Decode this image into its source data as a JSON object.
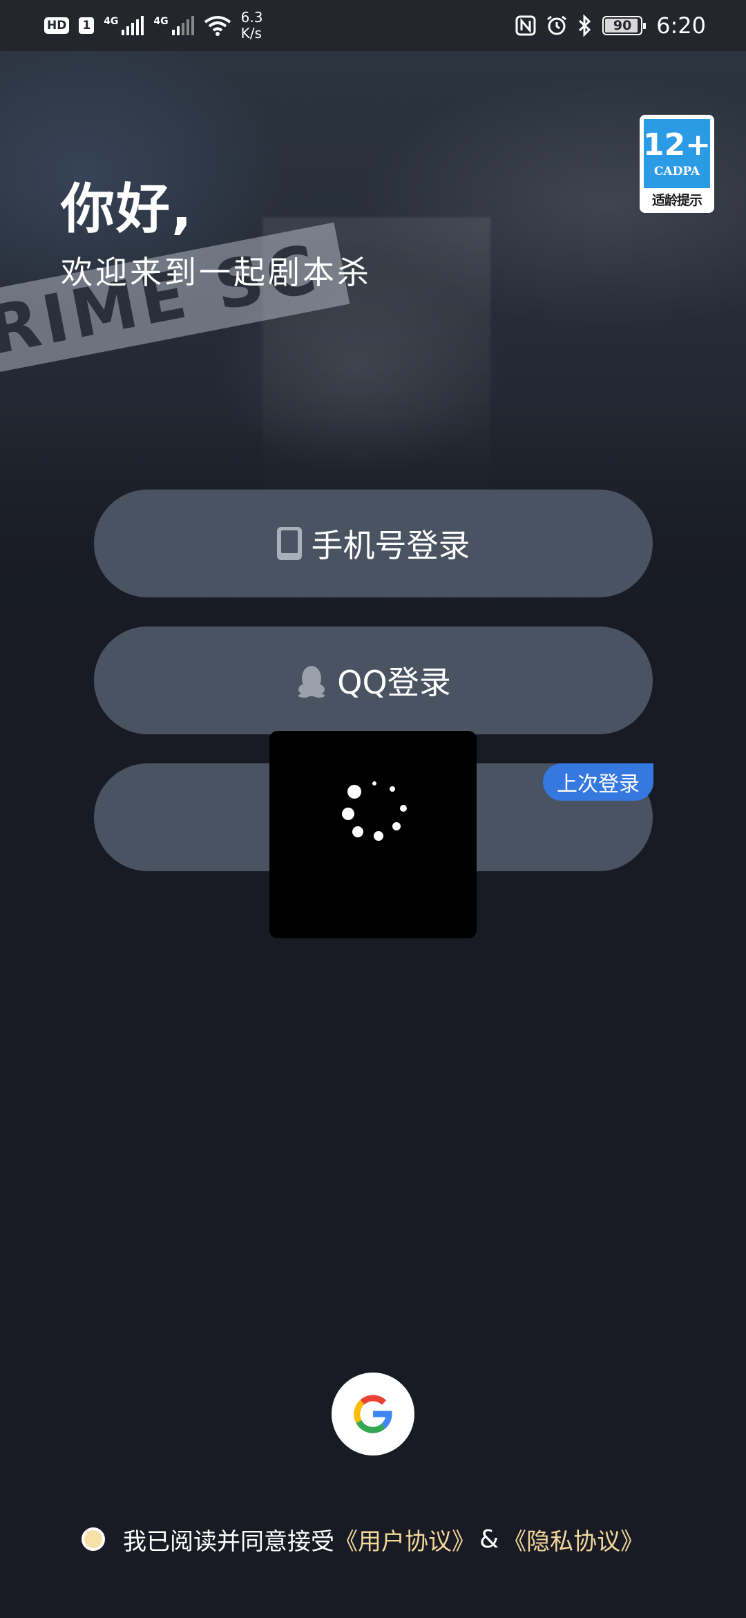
{
  "status_bar": {
    "hd": "HD",
    "sim": "1",
    "net1": "4G",
    "net2": "4G",
    "speed_value": "6.3",
    "speed_unit": "K/s",
    "battery": "90",
    "time": "6:20"
  },
  "hero": {
    "background_text": "RIME SC",
    "greeting": "你好,",
    "welcome": "欢迎来到一起剧本杀"
  },
  "age_rating": {
    "age": "12+",
    "org": "CADPA",
    "tip": "适龄提示"
  },
  "login": {
    "phone_label": "手机号登录",
    "qq_label": "QQ登录",
    "last_login_badge": "上次登录"
  },
  "agreement": {
    "prefix": "我已阅读并同意接受",
    "user_agreement": "《用户协议》",
    "amp": "&",
    "privacy_agreement": "《隐私协议》"
  },
  "colors": {
    "background": "#181b23",
    "button": "#4a5361",
    "badge_blue": "#3478e0",
    "link_gold": "#f3d79b"
  },
  "icons": {
    "phone": "phone-icon",
    "qq": "qq-penguin-icon",
    "google": "google-icon",
    "spinner": "loading-spinner-icon"
  }
}
